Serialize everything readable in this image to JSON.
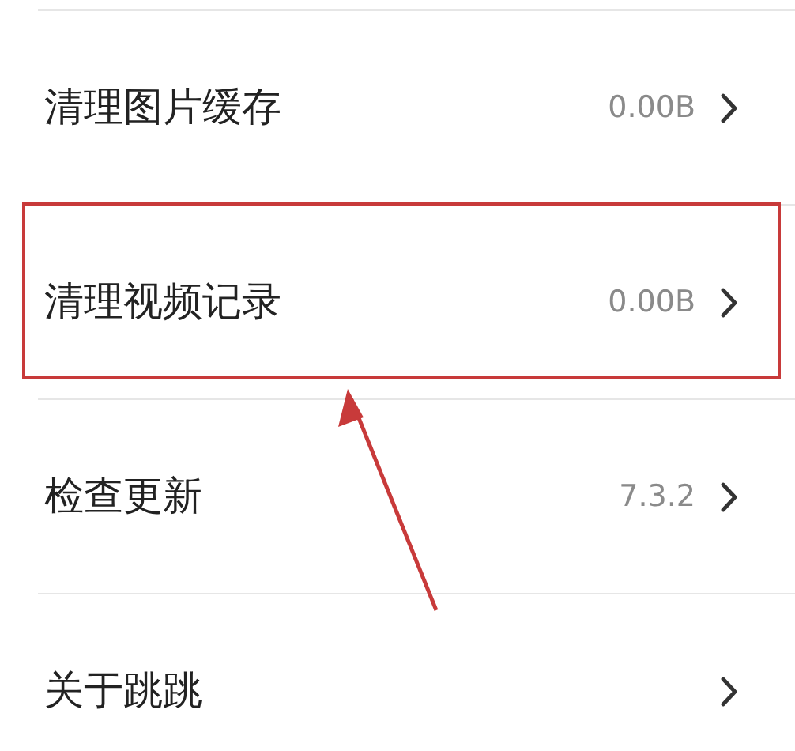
{
  "settings_rows": [
    {
      "label": "清理图片缓存",
      "value": "0.00B",
      "highlighted": false
    },
    {
      "label": "清理视频记录",
      "value": "0.00B",
      "highlighted": true
    },
    {
      "label": "检查更新",
      "value": "7.3.2",
      "highlighted": false
    },
    {
      "label": "关于跳跳",
      "highlighted": false
    }
  ]
}
